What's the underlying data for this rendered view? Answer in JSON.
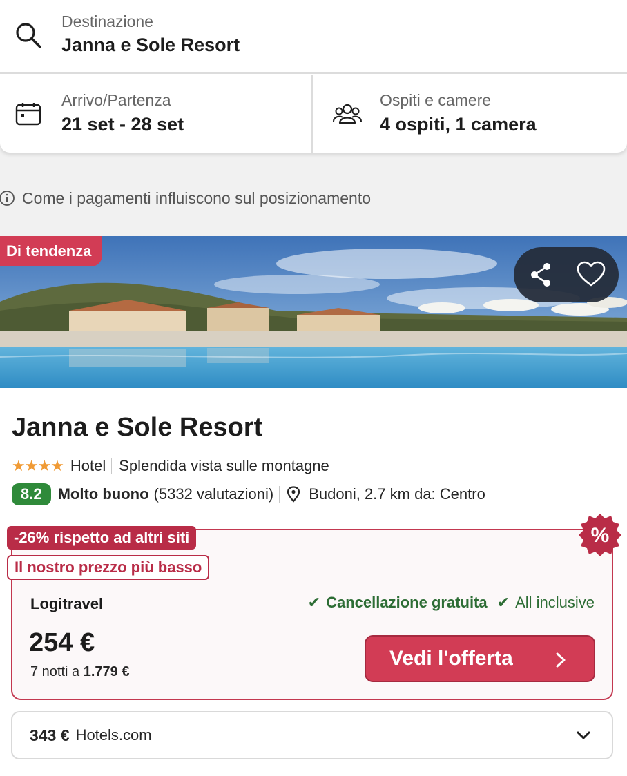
{
  "search": {
    "destination_label": "Destinazione",
    "destination_value": "Janna e Sole Resort",
    "dates_label": "Arrivo/Partenza",
    "dates_value": "21 set - 28 set",
    "guests_label": "Ospiti e camere",
    "guests_value": "4 ospiti, 1 camera",
    "icons": [
      "search-icon",
      "calendar-icon",
      "guests-icon"
    ]
  },
  "payment_note": "Come i pagamenti influiscono sul posizionamento",
  "hotel": {
    "badge": "Di tendenza",
    "name": "Janna e Sole Resort",
    "stars": "★★★★",
    "star_count": 4,
    "type": "Hotel",
    "highlight": "Splendida vista sulle montagne",
    "score": "8.2",
    "rating_word": "Molto buono",
    "reviews": "(5332 valutazioni)",
    "location": "Budoni, 2.7 km da: Centro",
    "icons": [
      "share-icon",
      "heart-icon",
      "location-pin-icon"
    ]
  },
  "offer": {
    "discount_tag": "-26% rispetto ad altri siti",
    "lowest_tag": "Il nostro prezzo più basso",
    "seal": "%",
    "provider": "Logitravel",
    "perk_1": "Cancellazione gratuita",
    "perk_2": "All inclusive",
    "check_glyph": "✔",
    "price": "254 €",
    "nights_prefix": "7 notti a",
    "nights_total": "1.779 €",
    "cta": "Vedi l'offerta"
  },
  "alt_offer": {
    "price": "343 €",
    "provider": "Hotels.com"
  },
  "colors": {
    "brand_red": "#d23c55",
    "score_green": "#2f8a3a",
    "perk_green": "#2d6d35",
    "star_orange": "#f09a34"
  }
}
